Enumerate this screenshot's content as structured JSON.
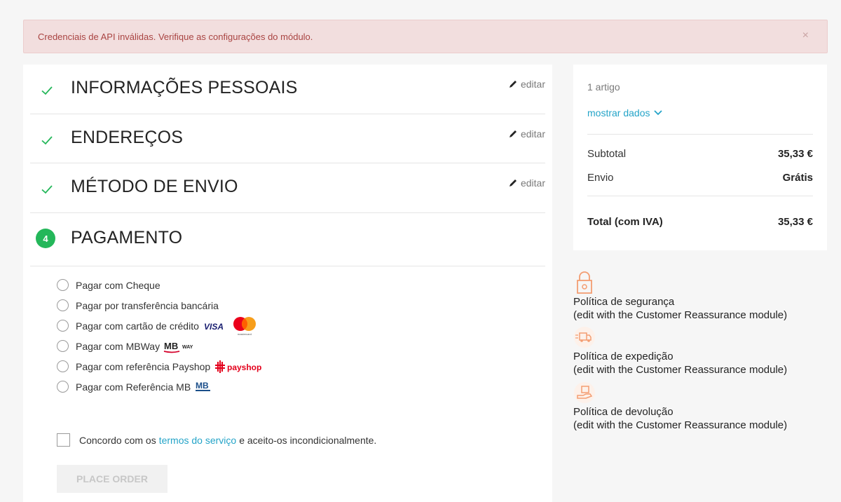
{
  "alert": {
    "message": "Credenciais de API inválidas. Verifique as configurações do módulo.",
    "close": "×"
  },
  "steps": [
    {
      "title": "INFORMAÇÕES PESSOAIS",
      "edit": "editar"
    },
    {
      "title": "ENDEREÇOS",
      "edit": "editar"
    },
    {
      "title": "MÉTODO DE ENVIO",
      "edit": "editar"
    },
    {
      "number": "4",
      "title": "PAGAMENTO"
    }
  ],
  "payment_options": [
    {
      "label": "Pagar com Cheque"
    },
    {
      "label": "Pagar por transferência bancária"
    },
    {
      "label": "Pagar com cartão de crédito",
      "logo": "visa-mastercard"
    },
    {
      "label": "Pagar com MBWay",
      "logo": "mbway"
    },
    {
      "label": "Pagar com referência Payshop",
      "logo": "payshop"
    },
    {
      "label": "Pagar com Referência MB",
      "logo": "multibanco"
    }
  ],
  "logos": {
    "visa": "VISA",
    "mastercard": "mastercard",
    "mb": "MB",
    "way": "WAY",
    "payshop": "payshop"
  },
  "terms": {
    "before": "Concordo com os",
    "link": "termos do serviço",
    "after": "e aceito-os incondicionalmente."
  },
  "place_order": "PLACE ORDER",
  "summary": {
    "items_count": "1 artigo",
    "show_details": "mostrar dados",
    "subtotal_label": "Subtotal",
    "subtotal_value": "35,33 €",
    "shipping_label": "Envio",
    "shipping_value": "Grátis",
    "total_label": "Total (com IVA)",
    "total_value": "35,33 €"
  },
  "reassurance": [
    {
      "title": "Política de segurança",
      "desc": "(edit with the Customer Reassurance module)"
    },
    {
      "title": "Política de expedição",
      "desc": "(edit with the Customer Reassurance module)"
    },
    {
      "title": "Política de devolução",
      "desc": "(edit with the Customer Reassurance module)"
    }
  ],
  "colors": {
    "accent": "#24a4c8",
    "success": "#24b75a",
    "alert_bg": "#f2dede",
    "alert_text": "#a94442",
    "reassurance_icon": "#f39d72"
  }
}
